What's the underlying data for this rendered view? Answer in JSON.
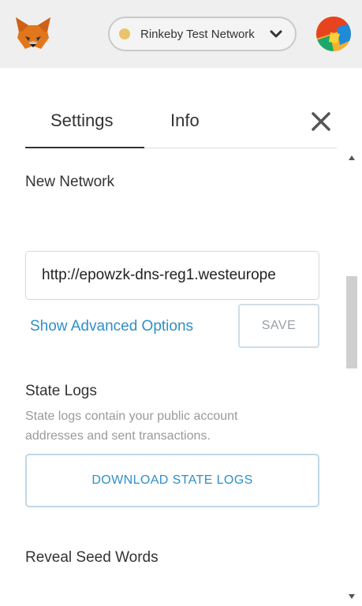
{
  "header": {
    "network": {
      "label": "Rinkeby Test Network",
      "dot_color": "#e9c46a"
    },
    "logo_icon": "metamask-fox-icon",
    "avatar_icon": "account-identicon"
  },
  "tabs": [
    {
      "label": "Settings",
      "active": true
    },
    {
      "label": "Info",
      "active": false
    }
  ],
  "close_icon": "close-icon",
  "new_network": {
    "title": "New Network",
    "rpc_url": "http://epowzk-dns-reg1.westeurope",
    "advanced_link": "Show Advanced Options",
    "save_label": "SAVE"
  },
  "state_logs": {
    "title": "State Logs",
    "description": "State logs contain your public account addresses and sent transactions.",
    "download_label": "DOWNLOAD STATE LOGS"
  },
  "seed_words": {
    "title": "Reveal Seed Words"
  },
  "colors": {
    "accent": "#2f8fc9",
    "header_bg": "#efefef"
  }
}
